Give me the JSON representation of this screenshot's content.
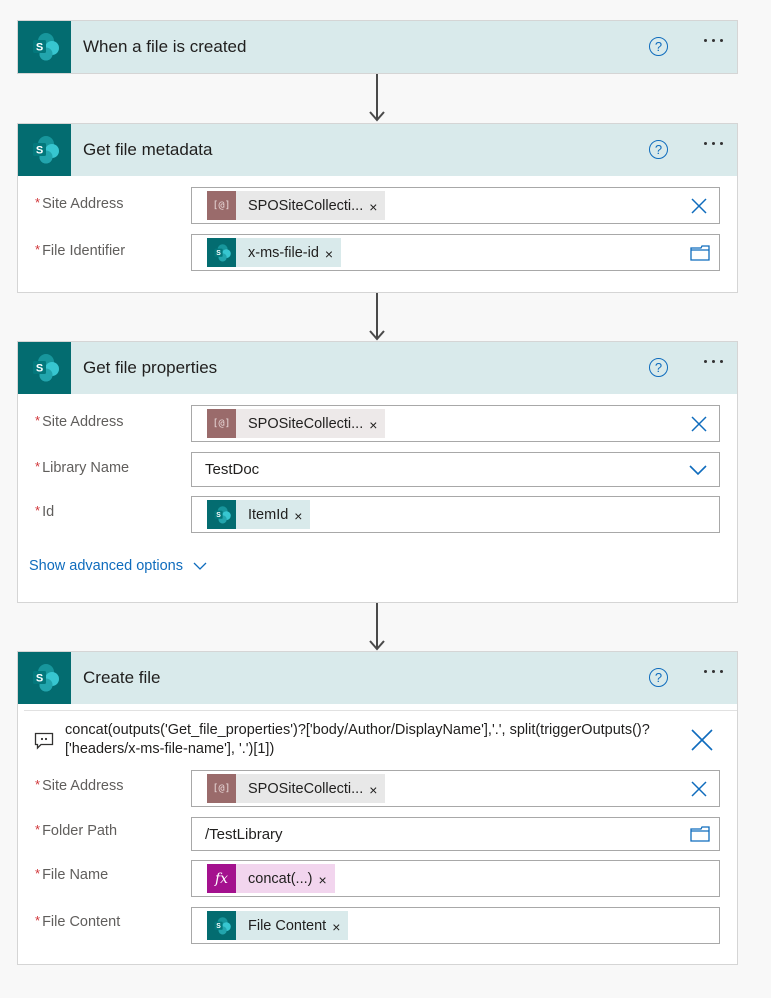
{
  "colors": {
    "sharepoint_teal": "#036c70",
    "header_bg": "#d9eaeb",
    "accent_blue": "#0f6cbd",
    "required_red": "#d13438",
    "variable_token": "#9a6b6b",
    "expression_token": "#a4118e"
  },
  "steps": [
    {
      "title": "When a file is created",
      "icon": "sharepoint-icon",
      "help_icon": "help-circle-icon",
      "more_icon": "more-ellipsis-icon"
    },
    {
      "title": "Get file metadata",
      "icon": "sharepoint-icon",
      "fields": [
        {
          "label": "Site Address",
          "required_mark": "*",
          "token": {
            "type": "variable",
            "icon": "variable-icon",
            "icon_text": "[@]",
            "label": "SPOSiteCollecti...",
            "remove": "×"
          },
          "action_icon": "clear-icon"
        },
        {
          "label": "File Identifier",
          "required_mark": "*",
          "token": {
            "type": "sharepoint",
            "icon": "sharepoint-icon",
            "label": "x-ms-file-id",
            "remove": "×"
          },
          "action_icon": "folder-icon"
        }
      ]
    },
    {
      "title": "Get file properties",
      "icon": "sharepoint-icon",
      "fields": [
        {
          "label": "Site Address",
          "required_mark": "*",
          "token": {
            "type": "variable",
            "icon": "variable-icon",
            "icon_text": "[@]",
            "label": "SPOSiteCollecti...",
            "remove": "×"
          },
          "action_icon": "clear-icon"
        },
        {
          "label": "Library Name",
          "required_mark": "*",
          "value": "TestDoc",
          "action_icon": "chevron-down-icon"
        },
        {
          "label": "Id",
          "required_mark": "*",
          "token": {
            "type": "sharepoint",
            "icon": "sharepoint-icon",
            "label": "ItemId",
            "remove": "×"
          }
        }
      ],
      "advanced_link": "Show advanced options"
    },
    {
      "title": "Create file",
      "icon": "sharepoint-icon",
      "comment": "concat(outputs('Get_file_properties')?['body/Author/DisplayName'],'.', split(triggerOutputs()?['headers/x-ms-file-name'], '.')[1])",
      "fields": [
        {
          "label": "Site Address",
          "required_mark": "*",
          "token": {
            "type": "variable",
            "icon": "variable-icon",
            "icon_text": "[@]",
            "label": "SPOSiteCollecti...",
            "remove": "×"
          },
          "action_icon": "clear-icon"
        },
        {
          "label": "Folder Path",
          "required_mark": "*",
          "value": "/TestLibrary",
          "action_icon": "folder-icon"
        },
        {
          "label": "File Name",
          "required_mark": "*",
          "token": {
            "type": "expression",
            "icon": "fx-icon",
            "icon_text": "fx",
            "label": "concat(...)",
            "remove": "×"
          }
        },
        {
          "label": "File Content",
          "required_mark": "*",
          "token": {
            "type": "sharepoint",
            "icon": "sharepoint-icon",
            "label": "File Content",
            "remove": "×"
          }
        }
      ]
    }
  ]
}
